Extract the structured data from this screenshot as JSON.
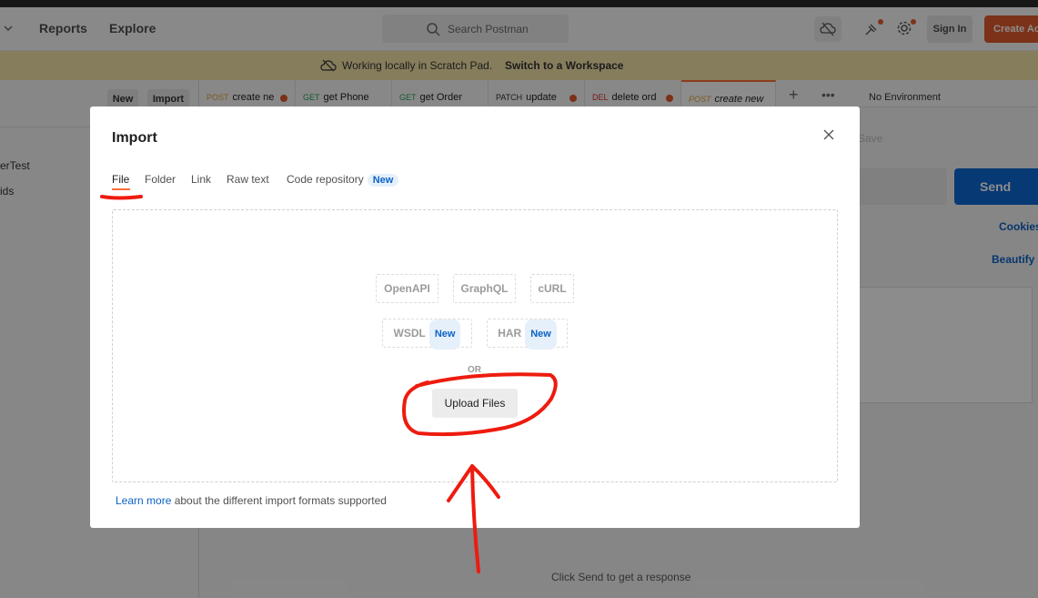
{
  "header": {
    "reports": "Reports",
    "explore": "Explore",
    "search_placeholder": "Search Postman",
    "sign_in": "Sign In",
    "create_account": "Create Account"
  },
  "banner": {
    "text": "Working locally in Scratch Pad.",
    "link": "Switch to a Workspace"
  },
  "sidebar": {
    "new_button": "New",
    "import_button": "Import",
    "items": [
      {
        "label": "erTest"
      },
      {
        "label": "ids"
      }
    ]
  },
  "request_tabs": [
    {
      "method": "POST",
      "method_color": "#e5a13a",
      "name": "create ne"
    },
    {
      "method": "GET",
      "method_color": "#2ba35b",
      "name": "get Phone"
    },
    {
      "method": "GET",
      "method_color": "#2ba35b",
      "name": "get Order"
    },
    {
      "method": "PATCH",
      "method_color": "#333333",
      "name": "update"
    },
    {
      "method": "DEL",
      "method_color": "#d6322c",
      "name": "delete ord"
    },
    {
      "method": "POST",
      "method_color": "#e5a13a",
      "name": "create new"
    }
  ],
  "environment": "No Environment",
  "request": {
    "save": "Save",
    "send": "Send",
    "cookies": "Cookies",
    "beautify": "Beautify",
    "response_hint": "Click Send to get a response"
  },
  "modal": {
    "title": "Import",
    "tabs": [
      "File",
      "Folder",
      "Link",
      "Raw text",
      "Code repository"
    ],
    "new_badge": "New",
    "formats": {
      "openapi": "OpenAPI",
      "graphql": "GraphQL",
      "curl": "cURL",
      "wsdl": "WSDL",
      "har": "HAR"
    },
    "or": "OR",
    "upload": "Upload Files",
    "learn_more": "Learn more",
    "footer_rest": " about the different import formats supported"
  },
  "colors": {
    "accent": "#ff6c37",
    "primary": "#0d69d6",
    "annotation": "#ee1b0f"
  }
}
